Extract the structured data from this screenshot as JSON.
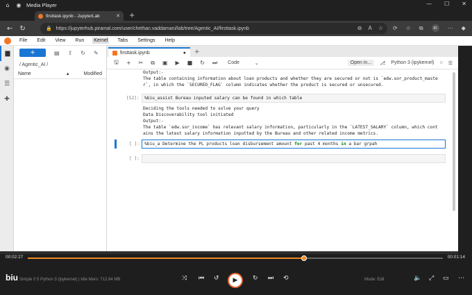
{
  "media_player": {
    "title": "Media Player"
  },
  "browser": {
    "tab_title": "firsttask.ipynb - JupyterLab",
    "url": "https://jupyterhub.piramal.com/user/chethan.vaddamani/lab/tree/Agentic_AI/firsttask.ipynb",
    "avatar_initials": "ID"
  },
  "jupyter": {
    "menu": [
      "File",
      "Edit",
      "View",
      "Run",
      "Kernel",
      "Tabs",
      "Settings",
      "Help"
    ],
    "active_menu": "Kernel",
    "filebrowser": {
      "new_label": "+",
      "path": "/ Agentic_AI /",
      "col_name": "Name",
      "col_modified": "Modified"
    },
    "notebook": {
      "tab_label": "firsttask.ipynb",
      "cell_type": "Code",
      "open_in": "Open in...",
      "kernel": "Python 3 (ipykernel)",
      "output1": "Output:-\nThe table containing information about loan products and whether they are secured or not is `edw.sor_product_maste\nr`, in which the `SECURED_FLAG` column indicates whether the product is secured or unsecured.",
      "cell52_prompt": "[52]:",
      "cell52_code": "%biu_assist Bureau inputed salary can be found in which table",
      "output2": "Deciding the tools needed to solve your query\nData Discoverability tool initiated\nOutput:-\nThe table `edw.sor_income` has relevant salary information, particularly in the `LATEST_SALARY` column, which cont\nains the latest salary information inputted by the Bureau and other related income metrics.",
      "active_prompt": "[ ]:",
      "active_code_pre": "%biu_a Determine the PL products loan disbursement amount ",
      "active_kw1": "for",
      "active_code_mid": " past 4 months ",
      "active_kw2": "in",
      "active_code_post": " a bar grpah",
      "empty_prompt": "[ ]:"
    }
  },
  "player": {
    "elapsed": "00:02:27",
    "remaining": "00:01:14",
    "progress": 0.665,
    "logo": "biu",
    "status_text": "Simple    0    5    Python 3 (ipykernel) | Idle    Mem: 712.84 MB",
    "status_right": "Mode: Edit"
  },
  "colors": {
    "accent": "#1976d2",
    "jupyter_orange": "#f37626",
    "progress": "#f08a24"
  }
}
